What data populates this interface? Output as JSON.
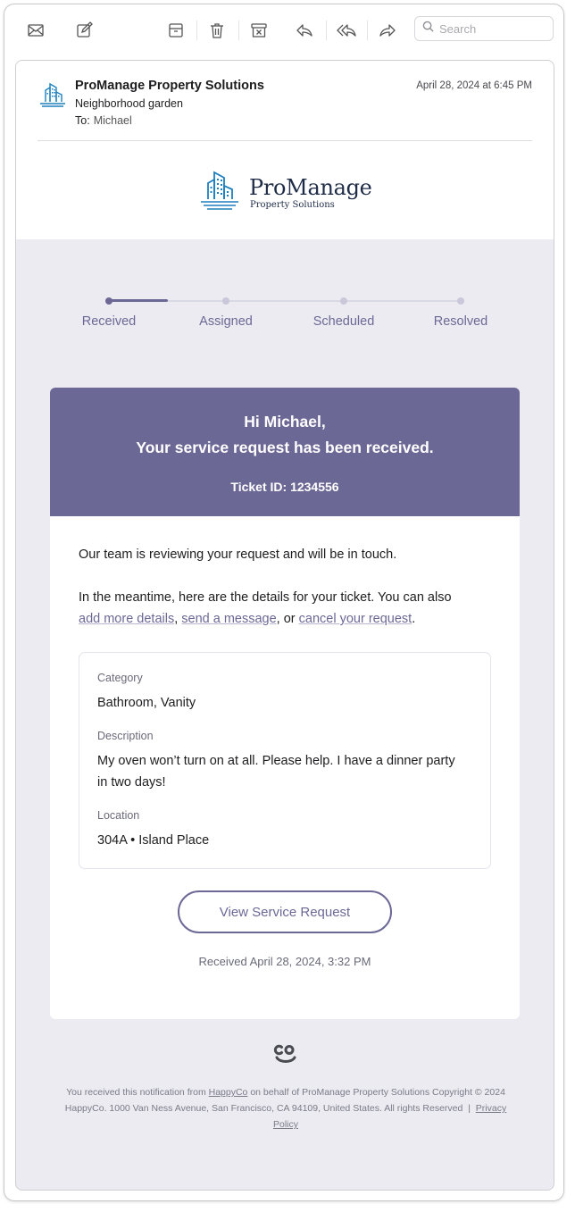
{
  "toolbar": {
    "icons": [
      "envelope-icon",
      "compose-icon",
      "archive-icon",
      "trash-icon",
      "junk-icon",
      "reply-icon",
      "reply-all-icon",
      "forward-icon"
    ],
    "search_placeholder": "Search"
  },
  "email": {
    "sender": "ProManage Property Solutions",
    "subject": "Neighborhood garden",
    "to_label": "To:",
    "to_value": "Michael",
    "date": "April 28, 2024 at 6:45 PM"
  },
  "brand": {
    "name": "ProManage",
    "tagline": "Property Solutions",
    "primary_color": "#6c6896",
    "logo_color": "#1e7fbe"
  },
  "progress": {
    "steps": [
      "Received",
      "Assigned",
      "Scheduled",
      "Resolved"
    ],
    "current_step": "Received"
  },
  "card": {
    "greeting": "Hi Michael,",
    "headline": "Your service request has been received.",
    "ticket_id": "Ticket ID: 1234556",
    "paragraph1": "Our team is reviewing your request and will be in touch.",
    "paragraph2_prefix": "In the meantime, here are the details for your ticket. You can also",
    "link_add_details": "add more details",
    "comma": ",",
    "link_send_message": "send a message",
    "or_text": ", or",
    "link_cancel": "cancel your request",
    "period": "."
  },
  "details": {
    "category_label": "Category",
    "category_value": "Bathroom, Vanity",
    "description_label": "Description",
    "description_value": "My oven won’t turn on at all. Please help. I have a dinner party in two days!",
    "location_label": "Location",
    "location_value": "304A • Island Place"
  },
  "action": {
    "button_label": "View Service Request",
    "received_text": "Received April 28, 2024, 3:32 PM"
  },
  "footer": {
    "line1_prefix": "You received this notification from",
    "happyco_link": "HappyCo",
    "line1_suffix": "on behalf of ProManage Property Solutions",
    "line2": "Copyright © 2024 HappyCo. 1000 Van Ness Avenue, San Francisco, CA 94109, United States. All rights Reserved",
    "separator": "|",
    "privacy_link": "Privacy Policy"
  }
}
